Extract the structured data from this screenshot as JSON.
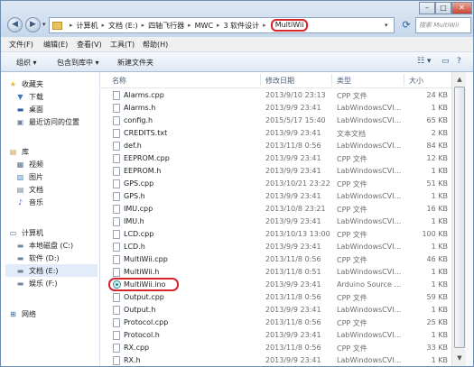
{
  "address": {
    "crumbs": [
      "计算机",
      "文档 (E:)",
      "四轴飞行器",
      "MWC",
      "3 软件设计"
    ],
    "current": "MultiWii",
    "search_placeholder": "搜索 MultiWii"
  },
  "window_controls": {
    "minimize": "–",
    "maximize": "□",
    "close": "✕"
  },
  "menu": [
    "文件(F)",
    "编辑(E)",
    "查看(V)",
    "工具(T)",
    "帮助(H)"
  ],
  "toolbar": {
    "organize": "组织 ▾",
    "include": "包含到库中 ▾",
    "new_folder": "新建文件夹"
  },
  "nav": {
    "favorites": {
      "header": "收藏夹",
      "items": [
        "下载",
        "桌面",
        "最近访问的位置"
      ]
    },
    "library": {
      "header": "库",
      "items": [
        "视频",
        "图片",
        "文档",
        "音乐"
      ]
    },
    "computer": {
      "header": "计算机",
      "items": [
        "本地磁盘 (C:)",
        "软件 (D:)",
        "文档 (E:)",
        "娱乐 (F:)"
      ]
    },
    "network": "网络"
  },
  "columns": {
    "name": "名称",
    "date": "修改日期",
    "type": "类型",
    "size": "大小"
  },
  "files": [
    {
      "name": "Alarms.cpp",
      "date": "2013/9/10 23:13",
      "type": "CPP 文件",
      "size": "24 KB"
    },
    {
      "name": "Alarms.h",
      "date": "2013/9/9 23:41",
      "type": "LabWindowsCVI...",
      "size": "1 KB"
    },
    {
      "name": "config.h",
      "date": "2015/5/17 15:40",
      "type": "LabWindowsCVI...",
      "size": "65 KB"
    },
    {
      "name": "CREDITS.txt",
      "date": "2013/9/9 23:41",
      "type": "文本文档",
      "size": "2 KB"
    },
    {
      "name": "def.h",
      "date": "2013/11/8 0:56",
      "type": "LabWindowsCVI...",
      "size": "84 KB"
    },
    {
      "name": "EEPROM.cpp",
      "date": "2013/9/9 23:41",
      "type": "CPP 文件",
      "size": "12 KB"
    },
    {
      "name": "EEPROM.h",
      "date": "2013/9/9 23:41",
      "type": "LabWindowsCVI...",
      "size": "1 KB"
    },
    {
      "name": "GPS.cpp",
      "date": "2013/10/21 23:22",
      "type": "CPP 文件",
      "size": "51 KB"
    },
    {
      "name": "GPS.h",
      "date": "2013/9/9 23:41",
      "type": "LabWindowsCVI...",
      "size": "1 KB"
    },
    {
      "name": "IMU.cpp",
      "date": "2013/10/8 23:21",
      "type": "CPP 文件",
      "size": "16 KB"
    },
    {
      "name": "IMU.h",
      "date": "2013/9/9 23:41",
      "type": "LabWindowsCVI...",
      "size": "1 KB"
    },
    {
      "name": "LCD.cpp",
      "date": "2013/10/13 13:00",
      "type": "CPP 文件",
      "size": "100 KB"
    },
    {
      "name": "LCD.h",
      "date": "2013/9/9 23:41",
      "type": "LabWindowsCVI...",
      "size": "1 KB"
    },
    {
      "name": "MultiWii.cpp",
      "date": "2013/11/8 0:56",
      "type": "CPP 文件",
      "size": "46 KB"
    },
    {
      "name": "MultiWii.h",
      "date": "2013/11/8 0:51",
      "type": "LabWindowsCVI...",
      "size": "1 KB"
    },
    {
      "name": "MultiWii.ino",
      "date": "2013/9/9 23:41",
      "type": "Arduino Source ...",
      "size": "1 KB"
    },
    {
      "name": "Output.cpp",
      "date": "2013/11/8 0:56",
      "type": "CPP 文件",
      "size": "59 KB"
    },
    {
      "name": "Output.h",
      "date": "2013/9/9 23:41",
      "type": "LabWindowsCVI...",
      "size": "1 KB"
    },
    {
      "name": "Protocol.cpp",
      "date": "2013/11/8 0:56",
      "type": "CPP 文件",
      "size": "25 KB"
    },
    {
      "name": "Protocol.h",
      "date": "2013/9/9 23:41",
      "type": "LabWindowsCVI...",
      "size": "1 KB"
    },
    {
      "name": "RX.cpp",
      "date": "2013/11/8 0:56",
      "type": "CPP 文件",
      "size": "33 KB"
    },
    {
      "name": "RX.h",
      "date": "2013/9/9 23:41",
      "type": "LabWindowsCVI...",
      "size": "1 KB"
    }
  ],
  "highlight_color": "#d6262b"
}
